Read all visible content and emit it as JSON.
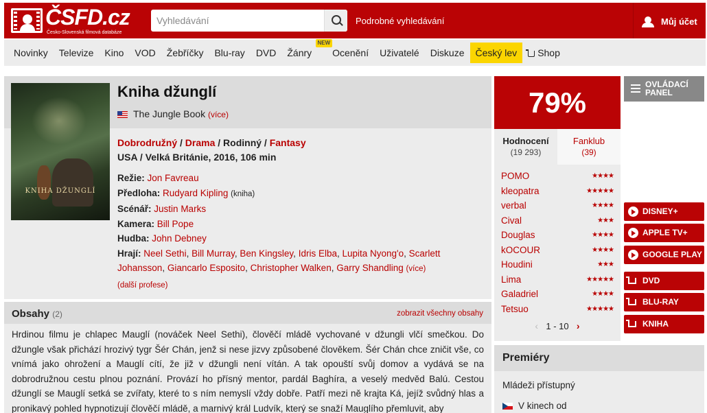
{
  "header": {
    "logo_text": "ČSFD.cz",
    "logo_subtitle": "Česko-Slovenská filmová databáze",
    "search_placeholder": "Vyhledávání",
    "advanced_search": "Podrobné vyhledávání",
    "account": "Můj účet",
    "accent_color": "#ba0305"
  },
  "nav": {
    "items": [
      "Novinky",
      "Televize",
      "Kino",
      "VOD",
      "Žebříčky",
      "Blu-ray",
      "DVD",
      "Žánry",
      "Ocenění",
      "Uživatelé",
      "Diskuze",
      "Český lev",
      "Shop"
    ],
    "badge": "NEW",
    "highlight_color": "#fbd500"
  },
  "movie": {
    "title": "Kniha džunglí",
    "poster_text": "KNIHA DŽUNGLÍ",
    "original_title": "The Jungle Book",
    "original_more": "(více)",
    "genres": [
      "Dobrodružný",
      "Drama",
      "Rodinný",
      "Fantasy"
    ],
    "genre_sep": " / ",
    "origin": "USA / Velká Británie, 2016, 106 min",
    "creators": {
      "director_label": "Režie:",
      "director": "Jon Favreau",
      "source_label": "Předloha:",
      "source": "Rudyard Kipling",
      "source_note": "(kniha)",
      "writer_label": "Scénář:",
      "writer": "Justin Marks",
      "camera_label": "Kamera:",
      "camera": "Bill Pope",
      "music_label": "Hudba:",
      "music": "John Debney",
      "cast_label": "Hrají:",
      "cast": [
        "Neel Sethi",
        "Bill Murray",
        "Ben Kingsley",
        "Idris Elba",
        "Lupita Nyong'o",
        "Scarlett Johansson",
        "Giancarlo Esposito",
        "Christopher Walken",
        "Garry Shandling"
      ],
      "cast_more": "(více)",
      "more_professions": "(další profese)"
    }
  },
  "plot": {
    "heading": "Obsahy",
    "count": "(2)",
    "show_all": "zobrazit všechny obsahy",
    "text": "Hrdinou filmu je chlapec Mauglí (nováček Neel Sethi), člověčí mládě vychované v džungli vlčí smečkou. Do džungle však přichází hrozivý tygr Šér Chán, jenž si nese jizvy způsobené člověkem. Šér Chán chce zničit vše, co vnímá jako ohrožení a Mauglí cítí, že již v džungli není vítán. A tak opouští svůj domov a vydává se na dobrodružnou cestu plnou poznání. Provází ho přísný mentor, pardál Baghíra, a veselý medvěd Balú. Cestou džunglí se Mauglí setká se zvířaty, které to s ním nemyslí vždy dobře. Patří mezi ně krajta Ká, jejíž svůdný hlas a pronikavý pohled hypnotizují člověčí mládě, a marnivý král Ludvík, který se snaží Mauglího přemluvit, aby"
  },
  "rating": {
    "value": "79%",
    "tabs": [
      {
        "label": "Hodnocení",
        "count": "(19 293)"
      },
      {
        "label": "Fanklub",
        "count": "(39)"
      }
    ],
    "raters": [
      {
        "name": "POMO",
        "stars": 4
      },
      {
        "name": "kleopatra",
        "stars": 5
      },
      {
        "name": "verbal",
        "stars": 4
      },
      {
        "name": "Cival",
        "stars": 3
      },
      {
        "name": "Douglas",
        "stars": 4
      },
      {
        "name": "kOCOUR",
        "stars": 4
      },
      {
        "name": "Houdini",
        "stars": 3
      },
      {
        "name": "Lima",
        "stars": 5
      },
      {
        "name": "Galadriel",
        "stars": 4
      },
      {
        "name": "Tetsuo",
        "stars": 5
      }
    ],
    "pager": "1 - 10",
    "pager_prev": "‹",
    "pager_next": "›"
  },
  "premieres": {
    "heading": "Premiéry",
    "line1": "Mládeži přístupný",
    "line2": "V kinech od"
  },
  "side": {
    "panel": "OVLÁDACÍ PANEL",
    "vod": [
      "DISNEY+",
      "APPLE TV+",
      "GOOGLE PLAY"
    ],
    "shop": [
      "DVD",
      "BLU-RAY",
      "KNIHA"
    ]
  }
}
